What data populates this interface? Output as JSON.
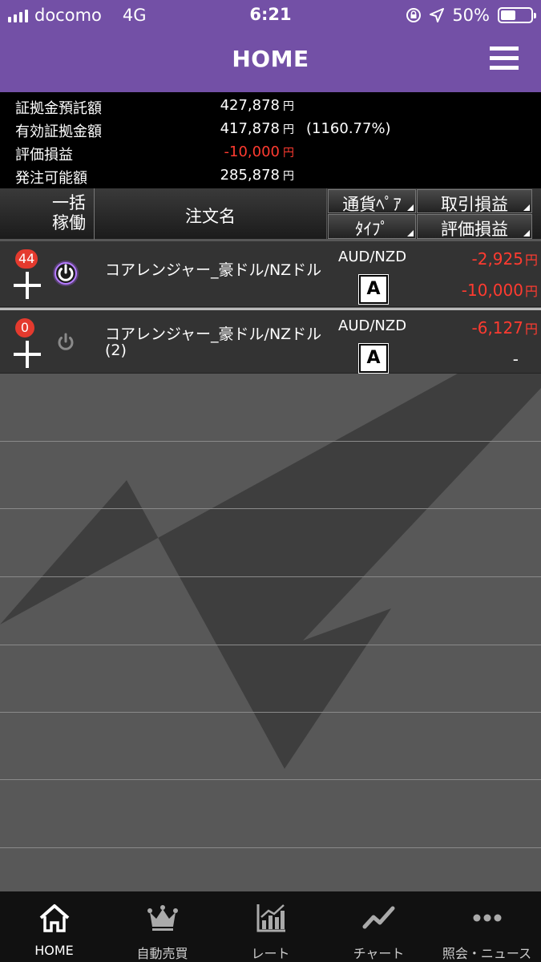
{
  "status_bar": {
    "carrier": "docomo",
    "network": "4G",
    "time": "6:21",
    "battery": "50%",
    "battery_level": 0.5
  },
  "header": {
    "title": "HOME"
  },
  "summary": {
    "rows": [
      {
        "label": "証拠金預託額",
        "value": "427,878",
        "unit": "円",
        "extra": ""
      },
      {
        "label": "有効証拠金額",
        "value": "417,878",
        "unit": "円",
        "extra": "(1160.77%)"
      },
      {
        "label": "評価損益",
        "value": "-10,000",
        "unit": "円",
        "extra": ""
      },
      {
        "label": "発注可能額",
        "value": "285,878",
        "unit": "円",
        "extra": ""
      }
    ]
  },
  "table_header": {
    "bulk_line1": "一括",
    "bulk_line2": "稼働",
    "order_name": "注文名",
    "currency_pair": "通貨ﾍﾟｱ",
    "type": "ﾀｲﾌﾟ",
    "trade_pl": "取引損益",
    "eval_pl": "評価損益"
  },
  "orders": [
    {
      "badge": "44",
      "name_line1": "コアレンジャー_豪ドル/NZドル",
      "name_line2": "",
      "pair": "AUD/NZD",
      "type": "A",
      "trade_pl": "-2,925",
      "trade_pl_unit": "円",
      "eval_pl": "-10,000",
      "eval_pl_unit": "円",
      "active": true
    },
    {
      "badge": "0",
      "name_line1": "コアレンジャー_豪ドル/NZドル",
      "name_line2": "(2)",
      "pair": "AUD/NZD",
      "type": "A",
      "trade_pl": "-6,127",
      "trade_pl_unit": "円",
      "eval_pl": "-",
      "eval_pl_unit": "",
      "active": false
    }
  ],
  "tabs": [
    {
      "label": "HOME",
      "icon": "home-icon"
    },
    {
      "label": "自動売買",
      "icon": "crown-icon"
    },
    {
      "label": "レート",
      "icon": "rate-chart-icon"
    },
    {
      "label": "チャート",
      "icon": "line-chart-icon"
    },
    {
      "label": "照会・ニュース",
      "icon": "more-dots-icon"
    }
  ],
  "colors": {
    "header_purple": "#7350a6",
    "loss_red": "#ff3b30",
    "badge_red": "#e43a2e",
    "power_active": "#a45bf0"
  }
}
